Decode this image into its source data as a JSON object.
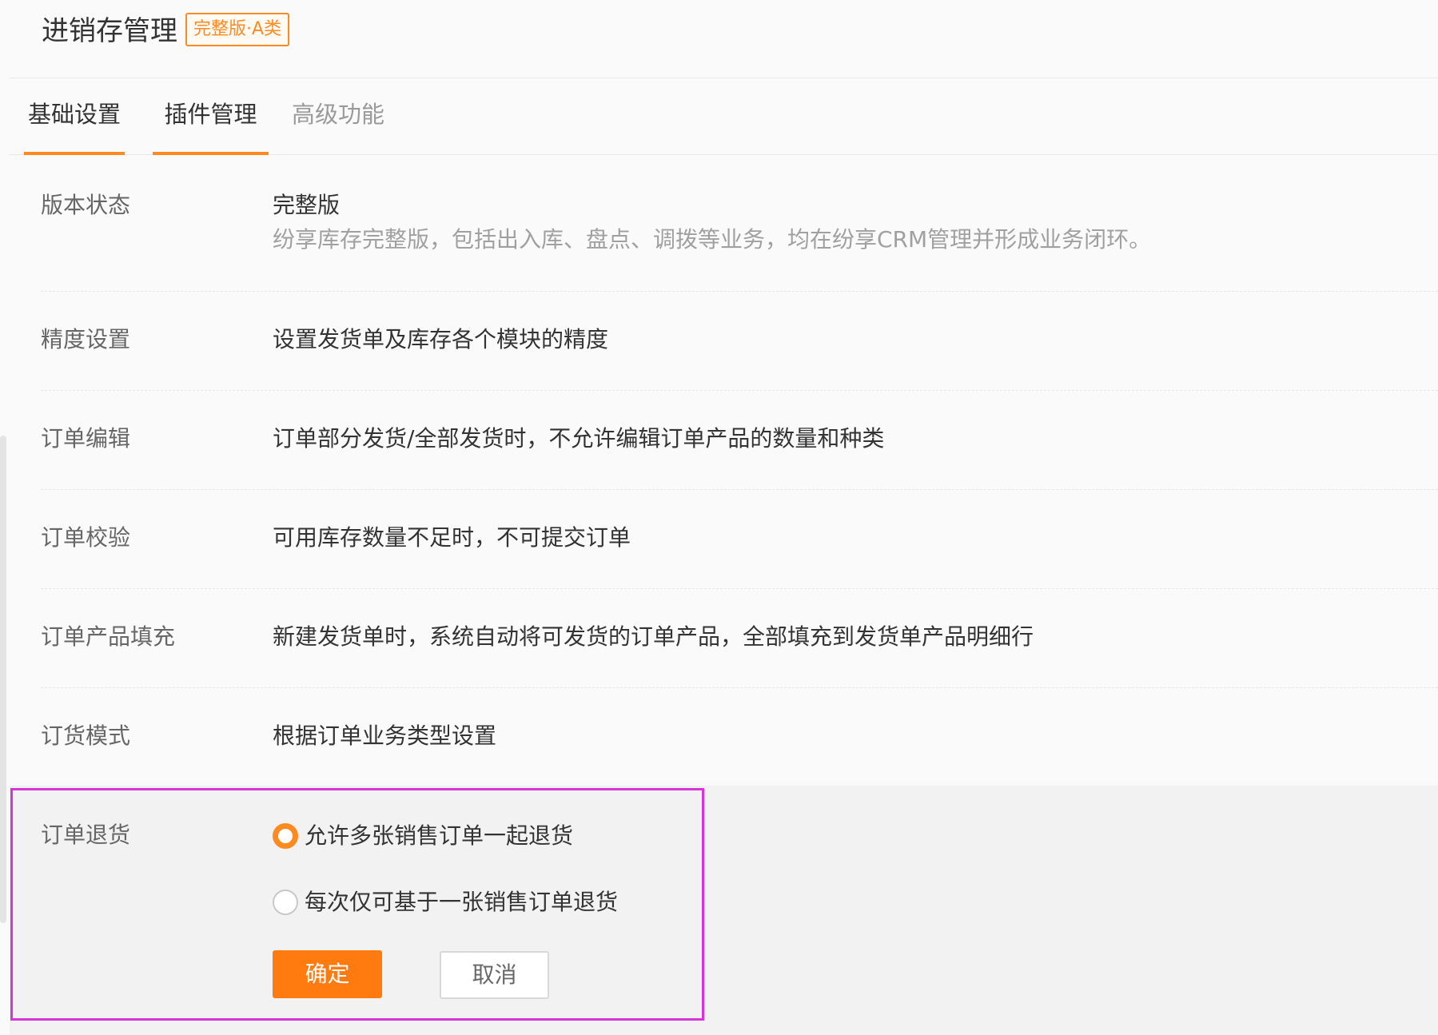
{
  "header": {
    "title": "进销存管理",
    "badge": "完整版·A类"
  },
  "tabs": [
    {
      "label": "基础设置",
      "active": true
    },
    {
      "label": "插件管理",
      "active": true
    },
    {
      "label": "高级功能",
      "active": false,
      "disabled": true
    }
  ],
  "settings": [
    {
      "label": "版本状态",
      "value": "完整版",
      "description": "纷享库存完整版，包括出入库、盘点、调拨等业务，均在纷享CRM管理并形成业务闭环。"
    },
    {
      "label": "精度设置",
      "value": "设置发货单及库存各个模块的精度"
    },
    {
      "label": "订单编辑",
      "value": "订单部分发货/全部发货时，不允许编辑订单产品的数量和种类"
    },
    {
      "label": "订单校验",
      "value": "可用库存数量不足时，不可提交订单"
    },
    {
      "label": "订单产品填充",
      "value": "新建发货单时，系统自动将可发货的订单产品，全部填充到发货单产品明细行"
    },
    {
      "label": "订货模式",
      "value": "根据订单业务类型设置"
    }
  ],
  "return_setting": {
    "label": "订单退货",
    "options": [
      {
        "label": "允许多张销售订单一起退货",
        "checked": true
      },
      {
        "label": "每次仅可基于一张销售订单退货",
        "checked": false
      }
    ],
    "confirm_label": "确定",
    "cancel_label": "取消"
  },
  "colors": {
    "accent": "#ff8a1f",
    "primary_button": "#ff7a0f",
    "highlight_border": "#d633d9"
  }
}
